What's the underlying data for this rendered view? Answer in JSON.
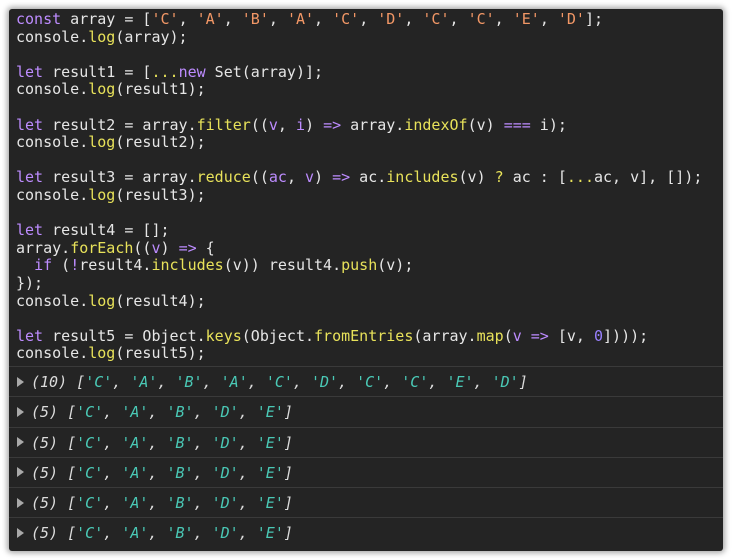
{
  "colors": {
    "background": "#242424",
    "keyword": "#bd8cff",
    "string": "#f29766",
    "function": "#e8e25a",
    "number": "#9980ff",
    "plain": "#e6e6e6",
    "console_string": "#4ac9b6",
    "divider": "#3a3a3a"
  },
  "editor": {
    "lines": [
      [
        [
          "kw",
          "const"
        ],
        [
          "plain",
          " array = ["
        ],
        [
          "str",
          "'C'"
        ],
        [
          "plain",
          ", "
        ],
        [
          "str",
          "'A'"
        ],
        [
          "plain",
          ", "
        ],
        [
          "str",
          "'B'"
        ],
        [
          "plain",
          ", "
        ],
        [
          "str",
          "'A'"
        ],
        [
          "plain",
          ", "
        ],
        [
          "str",
          "'C'"
        ],
        [
          "plain",
          ", "
        ],
        [
          "str",
          "'D'"
        ],
        [
          "plain",
          ", "
        ],
        [
          "str",
          "'C'"
        ],
        [
          "plain",
          ", "
        ],
        [
          "str",
          "'C'"
        ],
        [
          "plain",
          ", "
        ],
        [
          "str",
          "'E'"
        ],
        [
          "plain",
          ", "
        ],
        [
          "str",
          "'D'"
        ],
        [
          "plain",
          "];"
        ]
      ],
      [
        [
          "plain",
          "console."
        ],
        [
          "fn",
          "log"
        ],
        [
          "plain",
          "(array);"
        ]
      ],
      [],
      [
        [
          "kw",
          "let"
        ],
        [
          "plain",
          " result1 = ["
        ],
        [
          "fn",
          "..."
        ],
        [
          "kw",
          "new"
        ],
        [
          "plain",
          " Set(array)];"
        ]
      ],
      [
        [
          "plain",
          "console."
        ],
        [
          "fn",
          "log"
        ],
        [
          "plain",
          "(result1);"
        ]
      ],
      [],
      [
        [
          "kw",
          "let"
        ],
        [
          "plain",
          " result2 = array."
        ],
        [
          "fn",
          "filter"
        ],
        [
          "plain",
          "(("
        ],
        [
          "kw",
          "v"
        ],
        [
          "plain",
          ", "
        ],
        [
          "kw",
          "i"
        ],
        [
          "plain",
          ") "
        ],
        [
          "kw",
          "=>"
        ],
        [
          "plain",
          " array."
        ],
        [
          "fn",
          "indexOf"
        ],
        [
          "plain",
          "(v) "
        ],
        [
          "kw",
          "==="
        ],
        [
          "plain",
          " i);"
        ]
      ],
      [
        [
          "plain",
          "console."
        ],
        [
          "fn",
          "log"
        ],
        [
          "plain",
          "(result2);"
        ]
      ],
      [],
      [
        [
          "kw",
          "let"
        ],
        [
          "plain",
          " result3 = array."
        ],
        [
          "fn",
          "reduce"
        ],
        [
          "plain",
          "(("
        ],
        [
          "kw",
          "ac"
        ],
        [
          "plain",
          ", "
        ],
        [
          "kw",
          "v"
        ],
        [
          "plain",
          ") "
        ],
        [
          "kw",
          "=>"
        ],
        [
          "plain",
          " ac."
        ],
        [
          "fn",
          "includes"
        ],
        [
          "plain",
          "(v) "
        ],
        [
          "fn",
          "?"
        ],
        [
          "plain",
          " ac : ["
        ],
        [
          "fn",
          "..."
        ],
        [
          "plain",
          "ac, v], []);"
        ]
      ],
      [
        [
          "plain",
          "console."
        ],
        [
          "fn",
          "log"
        ],
        [
          "plain",
          "(result3);"
        ]
      ],
      [],
      [
        [
          "kw",
          "let"
        ],
        [
          "plain",
          " result4 = [];"
        ]
      ],
      [
        [
          "plain",
          "array."
        ],
        [
          "fn",
          "forEach"
        ],
        [
          "plain",
          "(("
        ],
        [
          "kw",
          "v"
        ],
        [
          "plain",
          ") "
        ],
        [
          "kw",
          "=>"
        ],
        [
          "plain",
          " {"
        ]
      ],
      [
        [
          "plain",
          "  "
        ],
        [
          "kw",
          "if"
        ],
        [
          "plain",
          " ("
        ],
        [
          "kw",
          "!"
        ],
        [
          "plain",
          "result4."
        ],
        [
          "fn",
          "includes"
        ],
        [
          "plain",
          "(v)) result4."
        ],
        [
          "fn",
          "push"
        ],
        [
          "plain",
          "(v);"
        ]
      ],
      [
        [
          "plain",
          "});"
        ]
      ],
      [
        [
          "plain",
          "console."
        ],
        [
          "fn",
          "log"
        ],
        [
          "plain",
          "(result4);"
        ]
      ],
      [],
      [
        [
          "kw",
          "let"
        ],
        [
          "plain",
          " result5 = Object."
        ],
        [
          "fn",
          "keys"
        ],
        [
          "plain",
          "(Object."
        ],
        [
          "fn",
          "fromEntries"
        ],
        [
          "plain",
          "(array."
        ],
        [
          "fn",
          "map"
        ],
        [
          "plain",
          "("
        ],
        [
          "kw",
          "v"
        ],
        [
          "plain",
          " "
        ],
        [
          "kw",
          "=>"
        ],
        [
          "plain",
          " [v, "
        ],
        [
          "num",
          "0"
        ],
        [
          "plain",
          "])));"
        ]
      ],
      [
        [
          "plain",
          "console."
        ],
        [
          "fn",
          "log"
        ],
        [
          "plain",
          "(result5);"
        ]
      ]
    ]
  },
  "console": {
    "rows": [
      {
        "count": "(10)",
        "items": [
          "'C'",
          "'A'",
          "'B'",
          "'A'",
          "'C'",
          "'D'",
          "'C'",
          "'C'",
          "'E'",
          "'D'"
        ]
      },
      {
        "count": "(5)",
        "items": [
          "'C'",
          "'A'",
          "'B'",
          "'D'",
          "'E'"
        ]
      },
      {
        "count": "(5)",
        "items": [
          "'C'",
          "'A'",
          "'B'",
          "'D'",
          "'E'"
        ]
      },
      {
        "count": "(5)",
        "items": [
          "'C'",
          "'A'",
          "'B'",
          "'D'",
          "'E'"
        ]
      },
      {
        "count": "(5)",
        "items": [
          "'C'",
          "'A'",
          "'B'",
          "'D'",
          "'E'"
        ]
      },
      {
        "count": "(5)",
        "items": [
          "'C'",
          "'A'",
          "'B'",
          "'D'",
          "'E'"
        ]
      }
    ]
  }
}
